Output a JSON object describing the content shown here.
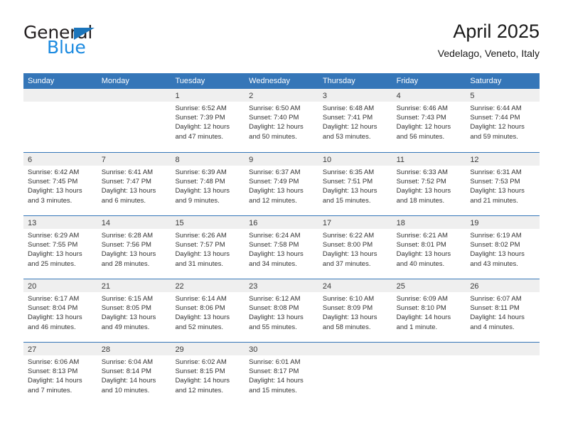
{
  "brand": {
    "word_one": "General",
    "word_two": "Blue",
    "flag_icon": "triangle-flag-icon"
  },
  "header": {
    "title": "April 2025",
    "subtitle": "Vedelago, Veneto, Italy"
  },
  "colors": {
    "header_blue": "#3576b8",
    "brand_dark": "#231f20",
    "brand_blue": "#1b8ae0",
    "row_band": "#efefef",
    "text": "#333333"
  },
  "calendar": {
    "weekdays": [
      "Sunday",
      "Monday",
      "Tuesday",
      "Wednesday",
      "Thursday",
      "Friday",
      "Saturday"
    ],
    "labels": {
      "sunrise": "Sunrise:",
      "sunset": "Sunset:",
      "daylight": "Daylight:"
    },
    "weeks": [
      [
        {
          "day": ""
        },
        {
          "day": ""
        },
        {
          "day": "1",
          "sunrise": "Sunrise: 6:52 AM",
          "sunset": "Sunset: 7:39 PM",
          "daylight": "Daylight: 12 hours and 47 minutes."
        },
        {
          "day": "2",
          "sunrise": "Sunrise: 6:50 AM",
          "sunset": "Sunset: 7:40 PM",
          "daylight": "Daylight: 12 hours and 50 minutes."
        },
        {
          "day": "3",
          "sunrise": "Sunrise: 6:48 AM",
          "sunset": "Sunset: 7:41 PM",
          "daylight": "Daylight: 12 hours and 53 minutes."
        },
        {
          "day": "4",
          "sunrise": "Sunrise: 6:46 AM",
          "sunset": "Sunset: 7:43 PM",
          "daylight": "Daylight: 12 hours and 56 minutes."
        },
        {
          "day": "5",
          "sunrise": "Sunrise: 6:44 AM",
          "sunset": "Sunset: 7:44 PM",
          "daylight": "Daylight: 12 hours and 59 minutes."
        }
      ],
      [
        {
          "day": "6",
          "sunrise": "Sunrise: 6:42 AM",
          "sunset": "Sunset: 7:45 PM",
          "daylight": "Daylight: 13 hours and 3 minutes."
        },
        {
          "day": "7",
          "sunrise": "Sunrise: 6:41 AM",
          "sunset": "Sunset: 7:47 PM",
          "daylight": "Daylight: 13 hours and 6 minutes."
        },
        {
          "day": "8",
          "sunrise": "Sunrise: 6:39 AM",
          "sunset": "Sunset: 7:48 PM",
          "daylight": "Daylight: 13 hours and 9 minutes."
        },
        {
          "day": "9",
          "sunrise": "Sunrise: 6:37 AM",
          "sunset": "Sunset: 7:49 PM",
          "daylight": "Daylight: 13 hours and 12 minutes."
        },
        {
          "day": "10",
          "sunrise": "Sunrise: 6:35 AM",
          "sunset": "Sunset: 7:51 PM",
          "daylight": "Daylight: 13 hours and 15 minutes."
        },
        {
          "day": "11",
          "sunrise": "Sunrise: 6:33 AM",
          "sunset": "Sunset: 7:52 PM",
          "daylight": "Daylight: 13 hours and 18 minutes."
        },
        {
          "day": "12",
          "sunrise": "Sunrise: 6:31 AM",
          "sunset": "Sunset: 7:53 PM",
          "daylight": "Daylight: 13 hours and 21 minutes."
        }
      ],
      [
        {
          "day": "13",
          "sunrise": "Sunrise: 6:29 AM",
          "sunset": "Sunset: 7:55 PM",
          "daylight": "Daylight: 13 hours and 25 minutes."
        },
        {
          "day": "14",
          "sunrise": "Sunrise: 6:28 AM",
          "sunset": "Sunset: 7:56 PM",
          "daylight": "Daylight: 13 hours and 28 minutes."
        },
        {
          "day": "15",
          "sunrise": "Sunrise: 6:26 AM",
          "sunset": "Sunset: 7:57 PM",
          "daylight": "Daylight: 13 hours and 31 minutes."
        },
        {
          "day": "16",
          "sunrise": "Sunrise: 6:24 AM",
          "sunset": "Sunset: 7:58 PM",
          "daylight": "Daylight: 13 hours and 34 minutes."
        },
        {
          "day": "17",
          "sunrise": "Sunrise: 6:22 AM",
          "sunset": "Sunset: 8:00 PM",
          "daylight": "Daylight: 13 hours and 37 minutes."
        },
        {
          "day": "18",
          "sunrise": "Sunrise: 6:21 AM",
          "sunset": "Sunset: 8:01 PM",
          "daylight": "Daylight: 13 hours and 40 minutes."
        },
        {
          "day": "19",
          "sunrise": "Sunrise: 6:19 AM",
          "sunset": "Sunset: 8:02 PM",
          "daylight": "Daylight: 13 hours and 43 minutes."
        }
      ],
      [
        {
          "day": "20",
          "sunrise": "Sunrise: 6:17 AM",
          "sunset": "Sunset: 8:04 PM",
          "daylight": "Daylight: 13 hours and 46 minutes."
        },
        {
          "day": "21",
          "sunrise": "Sunrise: 6:15 AM",
          "sunset": "Sunset: 8:05 PM",
          "daylight": "Daylight: 13 hours and 49 minutes."
        },
        {
          "day": "22",
          "sunrise": "Sunrise: 6:14 AM",
          "sunset": "Sunset: 8:06 PM",
          "daylight": "Daylight: 13 hours and 52 minutes."
        },
        {
          "day": "23",
          "sunrise": "Sunrise: 6:12 AM",
          "sunset": "Sunset: 8:08 PM",
          "daylight": "Daylight: 13 hours and 55 minutes."
        },
        {
          "day": "24",
          "sunrise": "Sunrise: 6:10 AM",
          "sunset": "Sunset: 8:09 PM",
          "daylight": "Daylight: 13 hours and 58 minutes."
        },
        {
          "day": "25",
          "sunrise": "Sunrise: 6:09 AM",
          "sunset": "Sunset: 8:10 PM",
          "daylight": "Daylight: 14 hours and 1 minute."
        },
        {
          "day": "26",
          "sunrise": "Sunrise: 6:07 AM",
          "sunset": "Sunset: 8:11 PM",
          "daylight": "Daylight: 14 hours and 4 minutes."
        }
      ],
      [
        {
          "day": "27",
          "sunrise": "Sunrise: 6:06 AM",
          "sunset": "Sunset: 8:13 PM",
          "daylight": "Daylight: 14 hours and 7 minutes."
        },
        {
          "day": "28",
          "sunrise": "Sunrise: 6:04 AM",
          "sunset": "Sunset: 8:14 PM",
          "daylight": "Daylight: 14 hours and 10 minutes."
        },
        {
          "day": "29",
          "sunrise": "Sunrise: 6:02 AM",
          "sunset": "Sunset: 8:15 PM",
          "daylight": "Daylight: 14 hours and 12 minutes."
        },
        {
          "day": "30",
          "sunrise": "Sunrise: 6:01 AM",
          "sunset": "Sunset: 8:17 PM",
          "daylight": "Daylight: 14 hours and 15 minutes."
        },
        {
          "day": ""
        },
        {
          "day": ""
        },
        {
          "day": ""
        }
      ]
    ]
  }
}
